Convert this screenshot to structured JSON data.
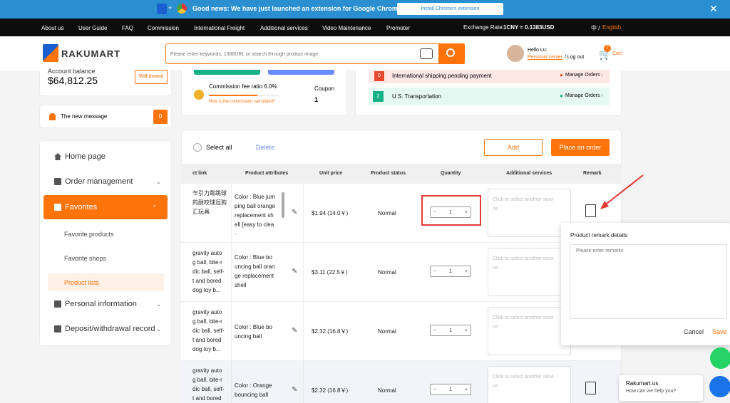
{
  "notification": {
    "text": "Good news: We have just launched an extension for Google Chrome",
    "button": "Install Chrome's extension",
    "plus": "+"
  },
  "topnav": {
    "items": [
      "About us",
      "User Guide",
      "FAQ",
      "Commission",
      "International Freight",
      "Additional services",
      "Video Maintenance",
      "Promoter"
    ],
    "exchange_label": "Exchange Rate:",
    "exchange_value": "1CNY ≈ 0.1383USD",
    "lang_cn": "中 /",
    "lang_en": "English"
  },
  "header": {
    "logo": "RAKUMART",
    "search_placeholder": "Please enter keywords, 1688URL or search through product image",
    "hello": "Hello Lu:",
    "personal_center": "Personal center",
    "logout": "/ Log out",
    "cart_label": "Cart",
    "cart_count": "7"
  },
  "sidebar": {
    "balance_label": "Account balance",
    "balance_value": "$64,812.25",
    "withdrawal": "Withdrawal",
    "message_label": "The new message",
    "message_count": "0",
    "items": [
      {
        "label": "Home page"
      },
      {
        "label": "Order management"
      },
      {
        "label": "Favorites"
      },
      {
        "label": "Favorite products"
      },
      {
        "label": "Favorite shops"
      },
      {
        "label": "Product lists"
      },
      {
        "label": "Personal information"
      },
      {
        "label": "Deposit/withdrawal record"
      }
    ]
  },
  "summary": {
    "commission": "Commission fee ratio 6.0%",
    "how": "How is the commission calculated?",
    "coupon_label": "Coupon",
    "coupon_value": "1",
    "status1_num": "0",
    "status1_text": "International shipping pending payment",
    "status1_link": "Manage Orders",
    "status2_num": "2",
    "status2_text": "U.S. Transportation",
    "status2_link": "Manage Orders"
  },
  "toolbar": {
    "select_all": "Select all",
    "delete": "Delete",
    "add": "Add",
    "place_order": "Place an order"
  },
  "table": {
    "headers": [
      "ct link",
      "Product attributes",
      "Unit price",
      "Product status",
      "Quantity",
      "Additional services",
      "Remark"
    ],
    "rows": [
      {
        "link": [
          "乍引力跳跳球",
          "的耐咬球逗狗",
          "汇玩具"
        ],
        "attr": [
          "Color : Blue jum",
          "ping ball orange",
          "replacement sh",
          "ell [easy to clea",
          "·"
        ],
        "price": "$1.94 (14.0￥)",
        "status": "Normal",
        "qty": "1",
        "svc": [
          "Click to select another servi",
          "ce"
        ]
      },
      {
        "link": [
          "gravity auto",
          "g ball, bite-r",
          "dic ball, self-",
          "t and bored",
          "dog toy b..."
        ],
        "attr": [
          "Color : Blue bo",
          "uncing ball oran",
          "ge replacement",
          "shell"
        ],
        "price": "$3.11 (22.5￥)",
        "status": "Normal",
        "qty": "1",
        "svc": [
          "Click to select another servi",
          "ce"
        ]
      },
      {
        "link": [
          "gravity auto",
          "g ball, bite-r",
          "dic ball, self-",
          "t and bored",
          "dog toy b..."
        ],
        "attr": [
          "Color : Blue bo",
          "uncing ball"
        ],
        "price": "$2.32 (16.8￥)",
        "status": "Normal",
        "qty": "1",
        "svc": [
          "Click to select another servi",
          "ce"
        ]
      },
      {
        "link": [
          "gravity auto",
          "g ball, bite-r",
          "dic ball, self-",
          "t and bored"
        ],
        "attr": [
          "Color : Orange",
          "bouncing ball"
        ],
        "price": "$2.32 (16.8￥)",
        "status": "Normal",
        "qty": "1",
        "svc": [
          "Click to select another servi",
          "ce"
        ]
      }
    ]
  },
  "remark_popup": {
    "title": "Product remark details",
    "placeholder": "Please enter remarks",
    "cancel": "Cancel",
    "save": "Save"
  },
  "chat": {
    "name": "Rakumart.us",
    "sub": "How can we help you?"
  },
  "colors": {
    "brand": "#ff730b",
    "notice": "#2a8fd0",
    "highlight": "#e53935"
  }
}
